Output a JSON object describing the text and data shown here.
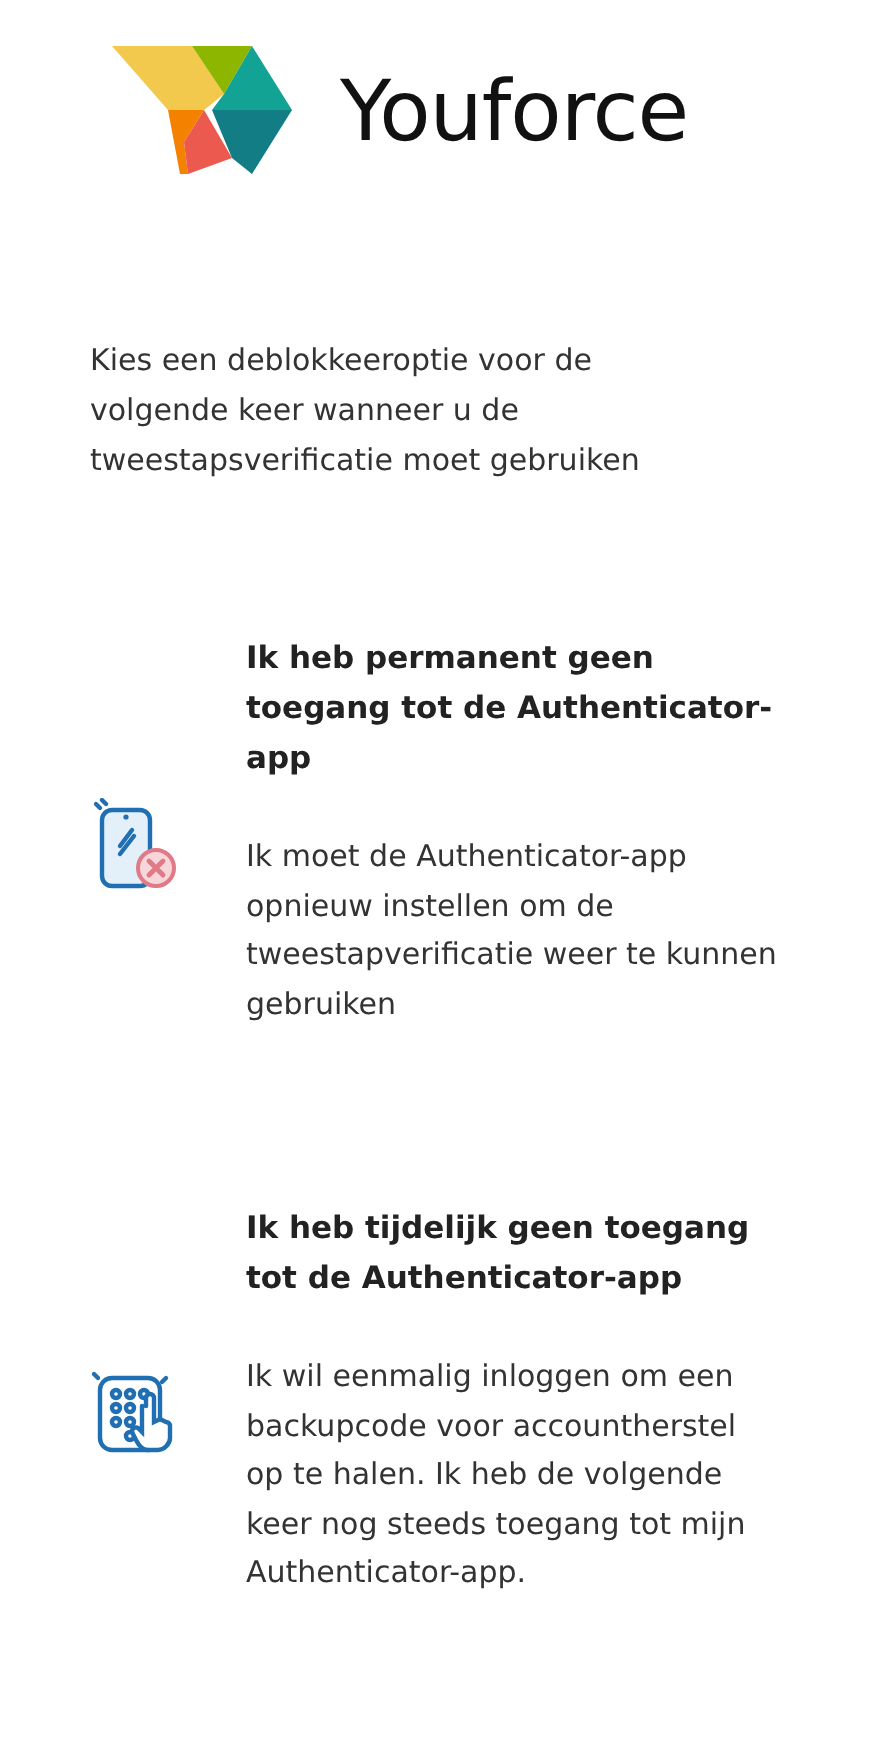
{
  "brand": {
    "name": "Youforce"
  },
  "intro": "Kies een deblokkeeroptie voor de volgende keer wanneer u de tweestapsverificatie moet gebruiken",
  "options": [
    {
      "kind": "phone-blocked",
      "title": "Ik heb permanent geen toegang tot de Authenticator-app",
      "description": "Ik moet de Authenticator-app opnieuw instellen om de tweestapverificatie weer te kunnen gebruiken"
    },
    {
      "kind": "keypad",
      "title": "Ik heb tijdelijk geen toegang tot de Authenticator-app",
      "description": "Ik wil eenmalig inloggen om een backupcode voor accountherstel op te halen. Ik heb de volgende keer nog steeds toegang tot mijn Authenticator-app."
    }
  ]
}
